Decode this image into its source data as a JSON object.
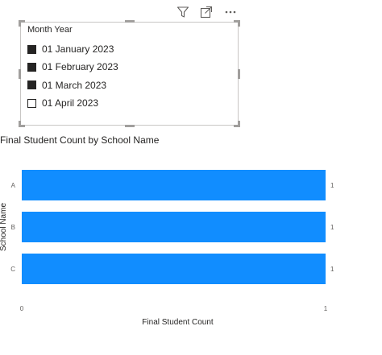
{
  "toolbar": {
    "filter_icon": "filter-icon",
    "focus_icon": "focus-mode-icon",
    "more_icon": "more-options-icon"
  },
  "slicer": {
    "title": "Month Year",
    "items": [
      {
        "label": "01 January 2023",
        "checked": true
      },
      {
        "label": "01 February 2023",
        "checked": true
      },
      {
        "label": "01 March 2023",
        "checked": true
      },
      {
        "label": "01 April 2023",
        "checked": false
      }
    ]
  },
  "chart": {
    "title": "Final Student Count by School Name"
  },
  "chart_data": {
    "type": "bar",
    "orientation": "horizontal",
    "title": "Final Student Count by School Name",
    "xlabel": "Final Student Count",
    "ylabel": "School Name",
    "categories": [
      "A",
      "B",
      "C"
    ],
    "values": [
      1,
      1,
      1
    ],
    "data_labels": [
      "1",
      "1",
      "1"
    ],
    "xlim": [
      0,
      1
    ],
    "x_ticks": [
      "0",
      "1"
    ],
    "grid": false,
    "bar_color": "#118DFF"
  },
  "colors": {
    "bar": "#118DFF",
    "text": "#252423",
    "axis_text": "#605E5C",
    "handle": "#A19F9D"
  }
}
